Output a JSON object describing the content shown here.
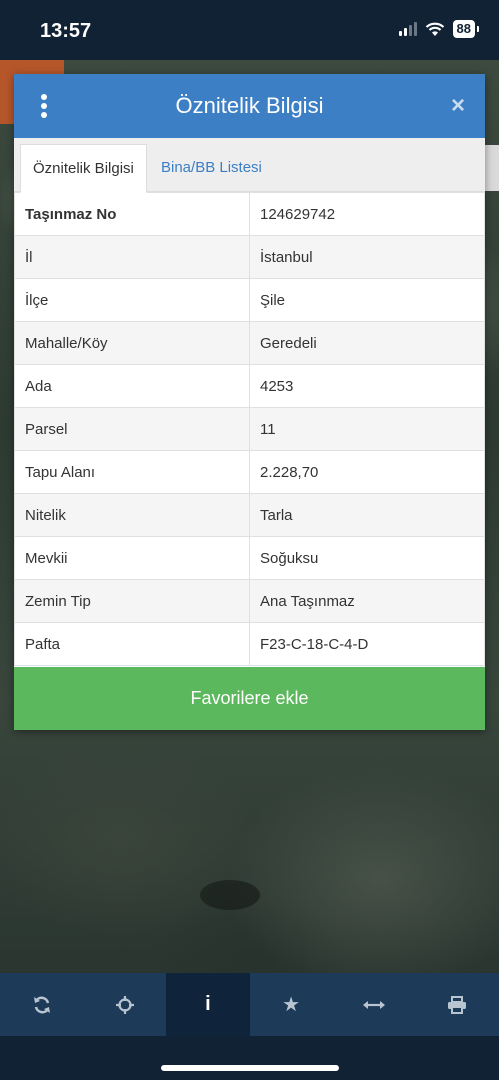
{
  "status_bar": {
    "time": "13:57",
    "battery": "88",
    "icons": [
      "signal-icon",
      "wifi-icon",
      "battery-icon"
    ]
  },
  "dialog": {
    "title": "Öznitelik Bilgisi",
    "menu_icon": "vertical-dots-icon",
    "close_icon": "close-icon",
    "close_symbol": "×",
    "tabs": [
      {
        "label": "Öznitelik Bilgisi",
        "active": true
      },
      {
        "label": "Bina/BB Listesi",
        "active": false
      }
    ],
    "rows": [
      {
        "key": "Taşınmaz No",
        "value": "124629742"
      },
      {
        "key": "İl",
        "value": "İstanbul"
      },
      {
        "key": "İlçe",
        "value": "Şile"
      },
      {
        "key": "Mahalle/Köy",
        "value": "Geredeli"
      },
      {
        "key": "Ada",
        "value": "4253"
      },
      {
        "key": "Parsel",
        "value": "11"
      },
      {
        "key": "Tapu Alanı",
        "value": "2.228,70"
      },
      {
        "key": "Nitelik",
        "value": "Tarla"
      },
      {
        "key": "Mevkii",
        "value": "Soğuksu"
      },
      {
        "key": "Zemin Tip",
        "value": "Ana Taşınmaz"
      },
      {
        "key": "Pafta",
        "value": "F23-C-18-C-4-D"
      }
    ],
    "favorite_button": "Favorilere ekle"
  },
  "toolbar": {
    "items": [
      {
        "icon": "refresh-icon",
        "glyph": "⟳",
        "active": false
      },
      {
        "icon": "crosshair-icon",
        "glyph": "⌖",
        "active": false
      },
      {
        "icon": "info-icon",
        "glyph": "i",
        "active": true
      },
      {
        "icon": "star-icon",
        "glyph": "★",
        "active": false
      },
      {
        "icon": "measure-icon",
        "glyph": "⟷",
        "active": false
      },
      {
        "icon": "print-icon",
        "glyph": "⎙",
        "active": false
      }
    ]
  },
  "colors": {
    "header_blue": "#3d7fc4",
    "favorite_green": "#5cb85c",
    "toolbar_navy": "#1d3a58",
    "status_bar_navy": "#102234"
  }
}
